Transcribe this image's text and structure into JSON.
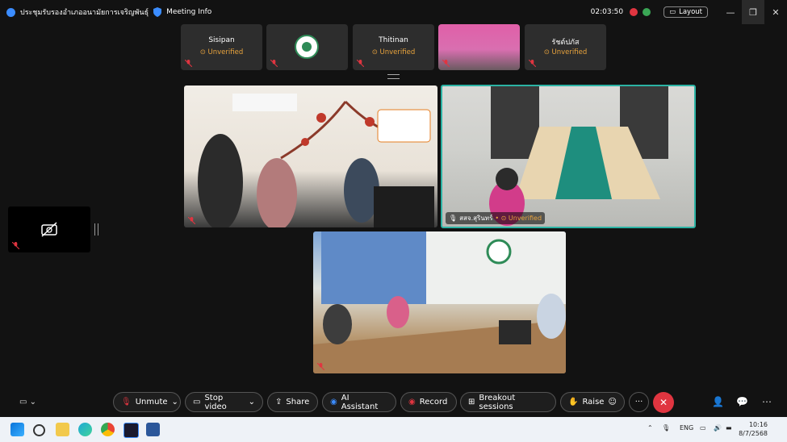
{
  "titlebar": {
    "meeting_title": "ประชุมรับรองอำเภออนามัยการเจริญพันธุ์",
    "meeting_info_label": "Meeting Info",
    "timer": "02:03:50",
    "layout_label": "Layout"
  },
  "thumbnails": [
    {
      "name": "Sisipan",
      "status": "Unverified"
    },
    {
      "name": "",
      "status": ""
    },
    {
      "name": "Thitinan",
      "status": "Unverified"
    },
    {
      "name": "",
      "status": ""
    },
    {
      "name": "รัชต์ปภัส",
      "status": "Unverified"
    }
  ],
  "videos": {
    "second_label_name": "สสจ.สุรินทร์",
    "second_label_status": "Unverified"
  },
  "controls": {
    "unmute": "Unmute",
    "stop_video": "Stop video",
    "share": "Share",
    "ai_assistant": "AI Assistant",
    "record": "Record",
    "breakout": "Breakout sessions",
    "raise": "Raise",
    "more": "···"
  },
  "taskbar": {
    "lang": "ENG",
    "time": "10:16",
    "date": "8/7/2568"
  },
  "colors": {
    "unverified": "#e8a33d",
    "active_speaker_border": "#2bb3a4",
    "end_call": "#e03540"
  }
}
